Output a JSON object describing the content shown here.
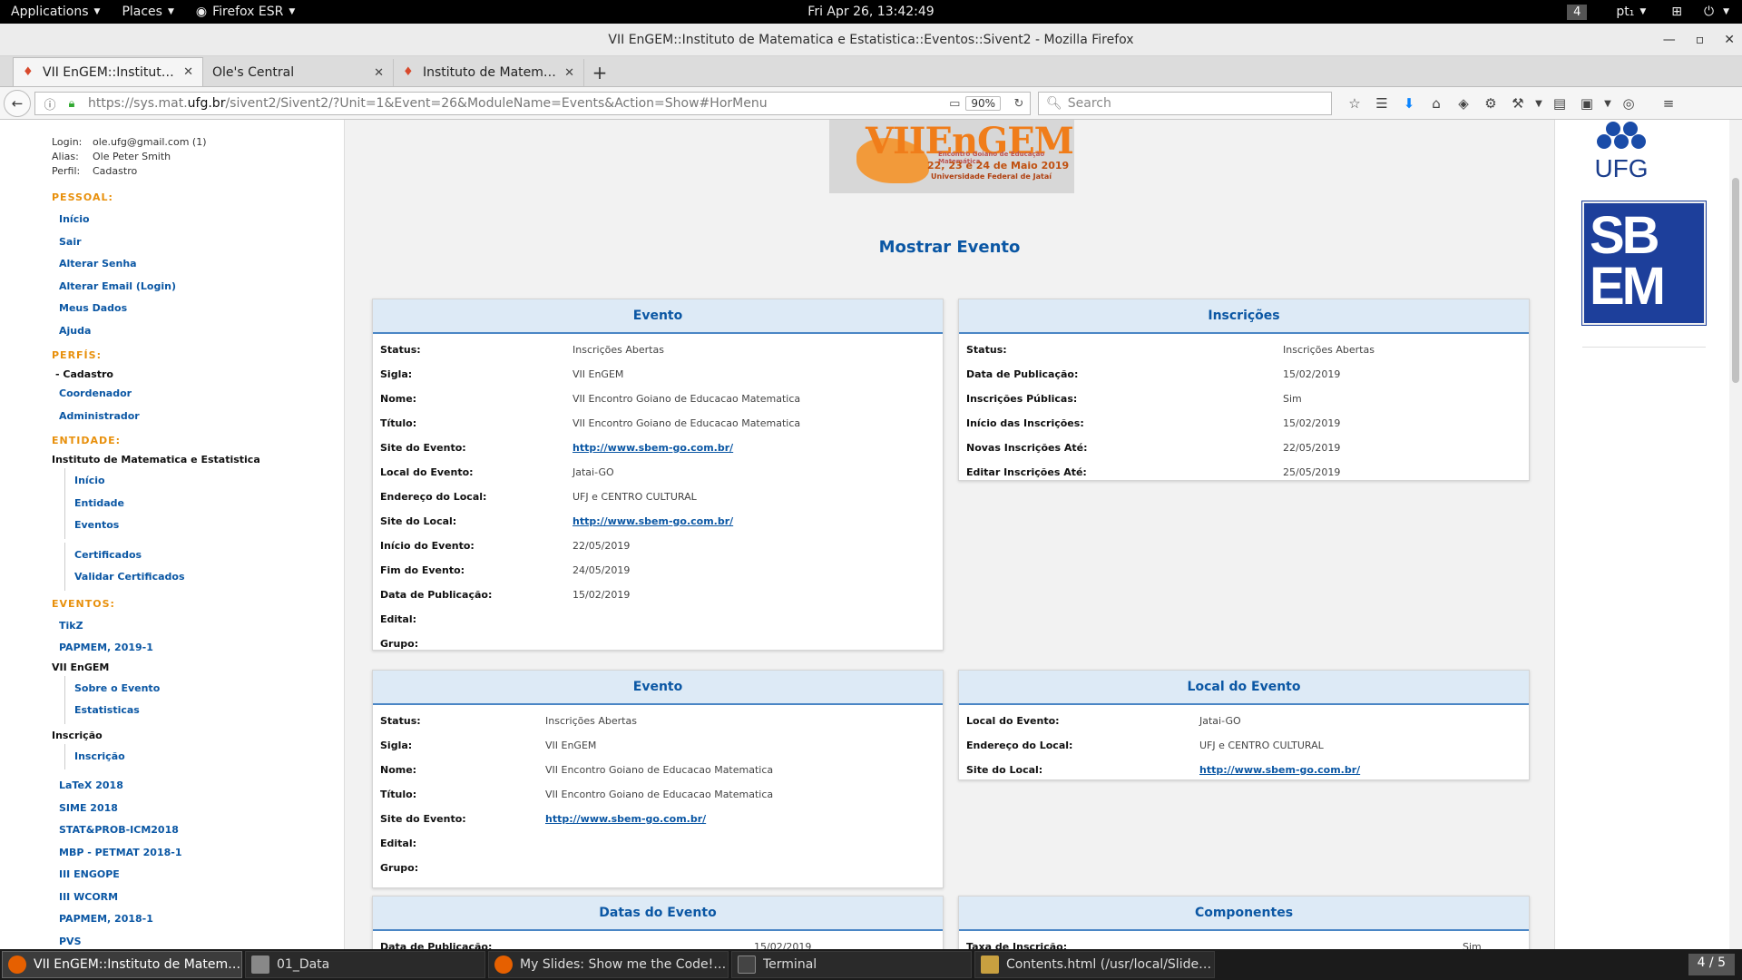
{
  "topbar": {
    "applications": "Applications",
    "places": "Places",
    "browser": "Firefox ESR",
    "clock": "Fri Apr 26, 13:42:49",
    "workspace": "4",
    "language": "pt₁"
  },
  "window": {
    "title": "VII EnGEM::Instituto de Matematica e Estatistica::Eventos::Sivent2 - Mozilla Firefox"
  },
  "tabs": [
    {
      "label": "VII EnGEM::Instituto d..."
    },
    {
      "label": "Ole's Central"
    },
    {
      "label": "Instituto de Matemati..."
    }
  ],
  "nav": {
    "url_prefix": "https://sys.mat.",
    "url_host": "ufg.br",
    "url_suffix": "/sivent2/Sivent2/?Unit=1&Event=26&ModuleName=Events&Action=Show#HorMenu",
    "zoom": "90%",
    "search_placeholder": "Search"
  },
  "sidebar": {
    "login_label": "Login:",
    "login_value": "ole.ufg@gmail.com (1)",
    "alias_label": "Alias:",
    "alias_value": "Ole Peter Smith",
    "perfil_label": "Perfil:",
    "perfil_value": "Cadastro",
    "pessoal_title": "PESSOAL:",
    "pessoal_links": [
      "Início",
      "Sair",
      "Alterar Senha",
      "Alterar Email (Login)",
      "Meus Dados",
      "Ajuda"
    ],
    "perfis_title": "PERFÍS:",
    "perfis_current": "- Cadastro",
    "perfis_links": [
      "Coordenador",
      "Administrador"
    ],
    "entidade_title": "ENTIDADE:",
    "entidade_name": "Instituto de Matematica e Estatistica",
    "entidade_links_a": [
      "Início",
      "Entidade",
      "Eventos"
    ],
    "entidade_links_b": [
      "Certificados",
      "Validar Certificados"
    ],
    "eventos_title": "EVENTOS:",
    "eventos_links_a": [
      "TikZ",
      "PAPMEM, 2019-1"
    ],
    "current_event": "VII EnGEM",
    "event_links": [
      "Sobre o Evento",
      "Estatisticas"
    ],
    "inscricao_label": "Inscrição",
    "inscricao_links": [
      "Inscrição"
    ],
    "eventos_links_b": [
      "LaTeX 2018",
      "SIME 2018",
      "STAT&PROB-ICM2018",
      "MBP - PETMAT 2018-1",
      "III ENGOPE",
      "III WCORM",
      "PAPMEM, 2018-1",
      "PVS"
    ]
  },
  "banner": {
    "logo": "VIIEnGEM",
    "subtitle": "Encontro Goiano de Educação Matemática",
    "dates": "22, 23 e 24 de Maio 2019",
    "university": "Universidade Federal de Jataí"
  },
  "page_title": "Mostrar Evento",
  "panels": {
    "evento1": {
      "title": "Evento",
      "rows": [
        {
          "k": "Status:",
          "v": "Inscrições Abertas"
        },
        {
          "k": "Sigla:",
          "v": "VII EnGEM"
        },
        {
          "k": "Nome:",
          "v": "VII Encontro Goiano de Educacao Matematica"
        },
        {
          "k": "Título:",
          "v": "VII Encontro Goiano de Educacao Matematica"
        },
        {
          "k": "Site do Evento:",
          "v": "http://www.sbem-go.com.br/",
          "link": true
        },
        {
          "k": "Local do Evento:",
          "v": "Jatai-GO"
        },
        {
          "k": "Endereço do Local:",
          "v": "UFJ e CENTRO CULTURAL"
        },
        {
          "k": "Site do Local:",
          "v": "http://www.sbem-go.com.br/",
          "link": true
        },
        {
          "k": "Início do Evento:",
          "v": "22/05/2019"
        },
        {
          "k": "Fim do Evento:",
          "v": "24/05/2019"
        },
        {
          "k": "Data de Publicação:",
          "v": "15/02/2019"
        },
        {
          "k": "Edital:",
          "v": ""
        },
        {
          "k": "Grupo:",
          "v": ""
        }
      ]
    },
    "inscricoes": {
      "title": "Inscrições",
      "rows": [
        {
          "k": "Status:",
          "v": "Inscrições Abertas"
        },
        {
          "k": "Data de Publicação:",
          "v": "15/02/2019"
        },
        {
          "k": "Inscrições Públicas:",
          "v": "Sim"
        },
        {
          "k": "Início das Inscrições:",
          "v": "15/02/2019"
        },
        {
          "k": "Novas Inscrições Até:",
          "v": "22/05/2019"
        },
        {
          "k": "Editar Inscrições Até:",
          "v": "25/05/2019"
        }
      ]
    },
    "evento2": {
      "title": "Evento",
      "rows": [
        {
          "k": "Status:",
          "v": "Inscrições Abertas"
        },
        {
          "k": "Sigla:",
          "v": "VII EnGEM"
        },
        {
          "k": "Nome:",
          "v": "VII Encontro Goiano de Educacao Matematica"
        },
        {
          "k": "Título:",
          "v": "VII Encontro Goiano de Educacao Matematica"
        },
        {
          "k": "Site do Evento:",
          "v": "http://www.sbem-go.com.br/",
          "link": true
        },
        {
          "k": "Edital:",
          "v": ""
        },
        {
          "k": "Grupo:",
          "v": ""
        }
      ]
    },
    "local": {
      "title": "Local do Evento",
      "rows": [
        {
          "k": "Local do Evento:",
          "v": "Jatai-GO"
        },
        {
          "k": "Endereço do Local:",
          "v": "UFJ e CENTRO CULTURAL"
        },
        {
          "k": "Site do Local:",
          "v": "http://www.sbem-go.com.br/",
          "link": true
        }
      ]
    },
    "datas": {
      "title": "Datas do Evento",
      "rows": [
        {
          "k": "Data de Publicação:",
          "v": "15/02/2019"
        }
      ]
    },
    "componentes": {
      "title": "Componentes",
      "rows": [
        {
          "k": "Taxa de Inscrição:",
          "v": "Sim"
        }
      ]
    }
  },
  "rightcol": {
    "ufg": "UFG",
    "sbem_line1": "SB",
    "sbem_line2": "EM"
  },
  "taskbar": [
    {
      "label": "VII EnGEM::Instituto de Matemati...",
      "icon": "firefox-icon",
      "color": "#e66000"
    },
    {
      "label": "01_Data",
      "icon": "document-icon",
      "color": "#888888"
    },
    {
      "label": "My Slides: Show me the Code! - M...",
      "icon": "firefox-icon",
      "color": "#e66000"
    },
    {
      "label": "Terminal",
      "icon": "terminal-icon",
      "color": "#444444"
    },
    {
      "label": "Contents.html (/usr/local/Slides/2...",
      "icon": "editor-icon",
      "color": "#c8a040"
    }
  ],
  "pager": "4 / 5"
}
